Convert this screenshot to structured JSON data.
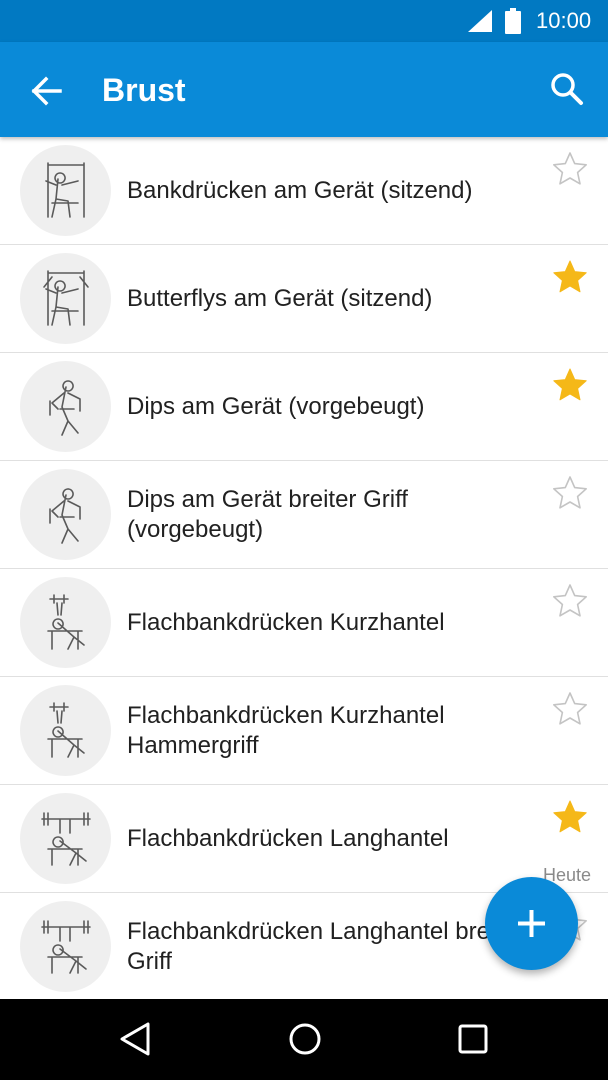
{
  "status_bar": {
    "time": "10:00",
    "icons": [
      "cellular-signal-icon",
      "battery-icon"
    ]
  },
  "app_bar": {
    "title": "Brust",
    "icons": [
      "back-arrow-icon",
      "search-icon"
    ]
  },
  "colors": {
    "status_bar": "#0179c2",
    "app_bar": "#0a8ad8",
    "star_filled": "#f5b818",
    "star_outline": "#c4c4c4",
    "thumb_bg": "#efefef",
    "fab": "#0a8ad8"
  },
  "exercises": [
    {
      "name": "Bankdrücken am Gerät (sitzend)",
      "favorite": false,
      "illustration": "seated-chest-press-machine"
    },
    {
      "name": "Butterflys am Gerät (sitzend)",
      "favorite": true,
      "illustration": "seated-butterfly-machine"
    },
    {
      "name": "Dips am Gerät (vorgebeugt)",
      "favorite": true,
      "illustration": "dip-machine"
    },
    {
      "name": "Dips am Gerät breiter Griff (vorgebeugt)",
      "favorite": false,
      "illustration": "dip-machine"
    },
    {
      "name": "Flachbankdrücken Kurzhantel",
      "favorite": false,
      "illustration": "dumbbell-bench-press"
    },
    {
      "name": "Flachbankdrücken Kurzhantel Hammergriff",
      "favorite": false,
      "illustration": "dumbbell-bench-press"
    },
    {
      "name": "Flachbankdrücken Langhantel",
      "favorite": true,
      "illustration": "barbell-bench-press",
      "last_done": "Heute"
    },
    {
      "name": "Flachbankdrücken Langhantel breiter Griff",
      "favorite": false,
      "illustration": "barbell-bench-press"
    }
  ],
  "fab": {
    "icon": "plus-icon"
  },
  "nav_bar": {
    "icons": [
      "nav-back-icon",
      "nav-home-icon",
      "nav-recents-icon"
    ]
  }
}
